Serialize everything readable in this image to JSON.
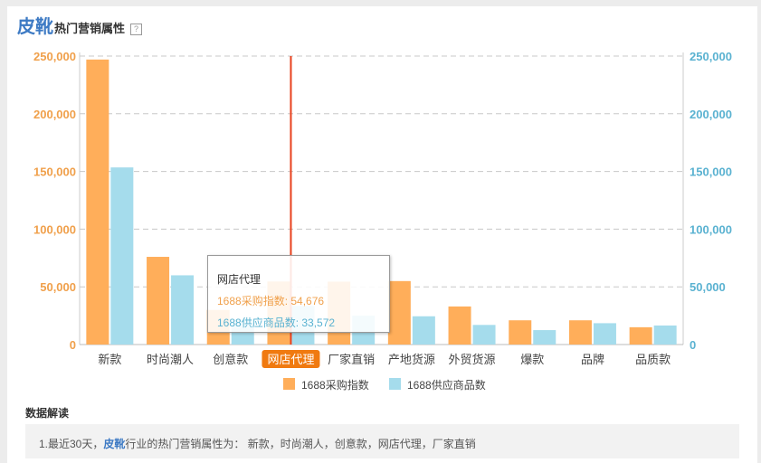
{
  "page": {
    "title_category": "皮靴",
    "title_suffix": "热门营销属性",
    "help_icon": "?",
    "section_heading": "数据解读",
    "note": {
      "prefix": "1.最近30天，",
      "category": "皮靴",
      "suffix": "行业的热门营销属性为： 新款，时尚潮人，创意款，网店代理，厂家直销"
    }
  },
  "tooltip": {
    "title": "网店代理",
    "line1": "1688采购指数: 54,676",
    "line2": "1688供应商品数: 33,572"
  },
  "colors": {
    "series_a": "#ffae5a",
    "series_b": "#a5dcec",
    "left_axis": "#f0a04b",
    "right_axis": "#5ab2d1",
    "crosshair": "#e8401c",
    "highlight_label_bg": "#f07a10",
    "accent_blue": "#3d7ac4"
  },
  "chart_data": {
    "type": "bar",
    "categories": [
      "新款",
      "时尚潮人",
      "创意款",
      "网店代理",
      "厂家直销",
      "产地货源",
      "外贸货源",
      "爆款",
      "品牌",
      "品质款"
    ],
    "series": [
      {
        "name": "1688采购指数",
        "axis": "left",
        "values": [
          247000,
          76000,
          30000,
          54676,
          54500,
          55000,
          33000,
          21000,
          21000,
          15000
        ]
      },
      {
        "name": "1688供应商品数",
        "axis": "right",
        "values": [
          153500,
          60000,
          22000,
          33572,
          25000,
          24500,
          17000,
          12500,
          18500,
          16500
        ]
      }
    ],
    "y_left": {
      "min": 0,
      "max": 250000,
      "ticks": [
        "0",
        "50,000",
        "100,000",
        "150,000",
        "200,000",
        "250,000"
      ]
    },
    "y_right": {
      "min": 0,
      "max": 250000,
      "ticks": [
        "0",
        "50,000",
        "100,000",
        "150,000",
        "200,000",
        "250,000"
      ]
    },
    "highlighted_category": "网店代理",
    "grid": "dashed horizontal",
    "legend_position": "bottom-center"
  }
}
